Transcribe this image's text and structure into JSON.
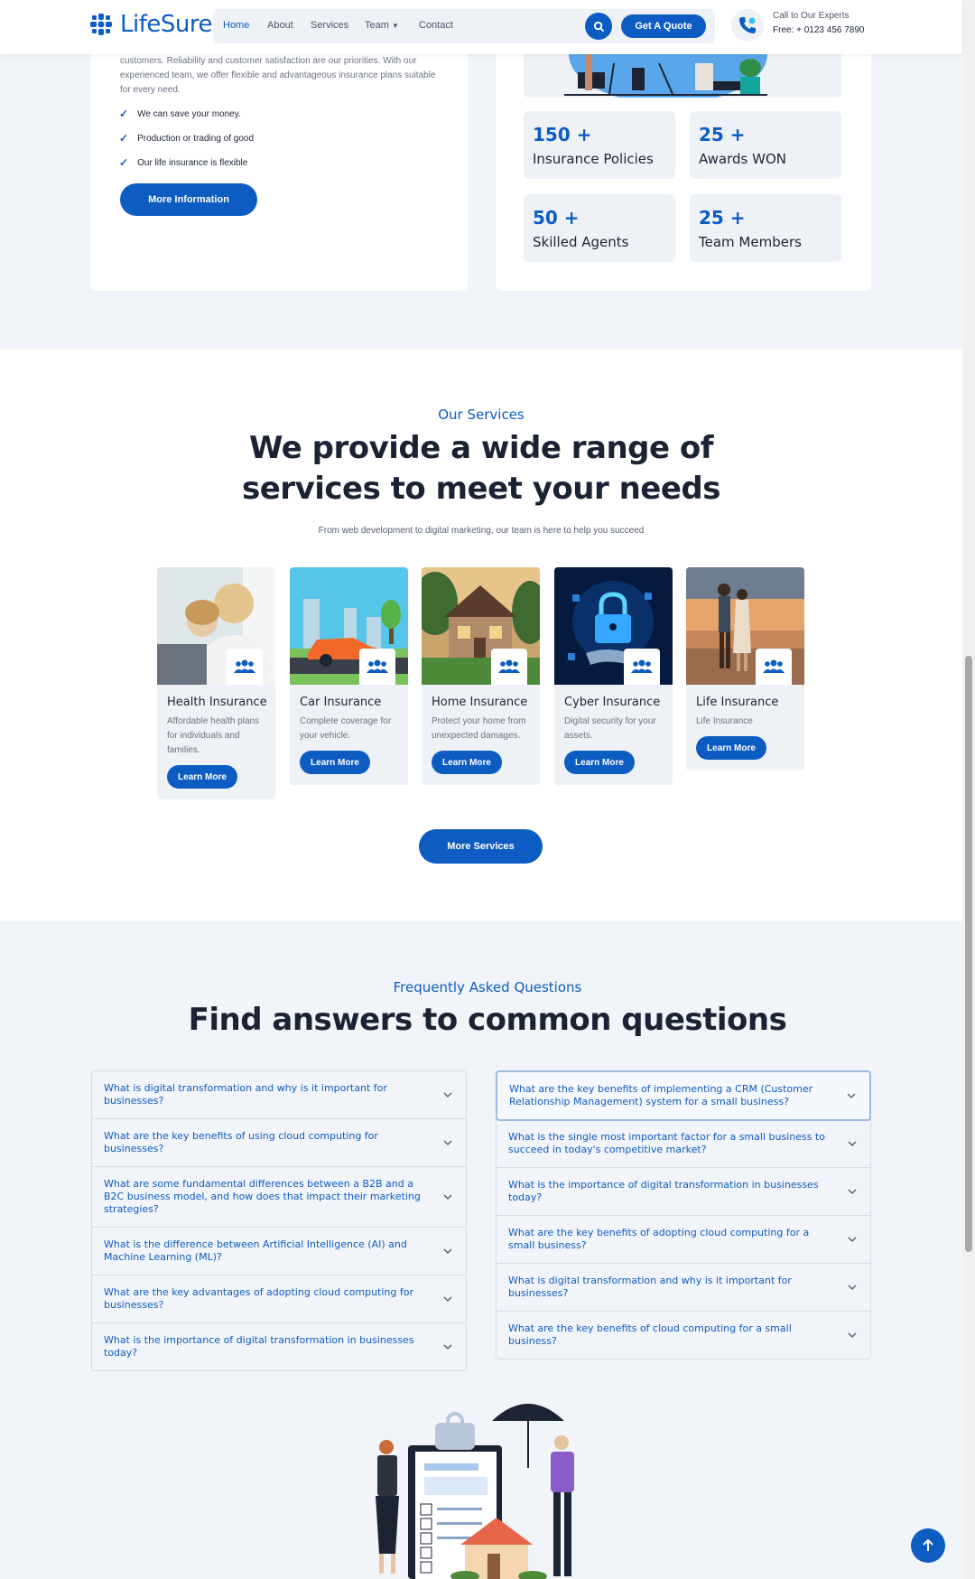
{
  "header": {
    "brand": "LifeSure",
    "nav": [
      {
        "label": "Home"
      },
      {
        "label": "About"
      },
      {
        "label": "Services"
      },
      {
        "label": "Team"
      },
      {
        "label": "Contact"
      }
    ],
    "quote_label": "Get A Quote",
    "call_label": "Call to Our Experts",
    "call_number": "Free: + 0123 456 7890"
  },
  "about": {
    "text": "customers. Reliability and customer satisfaction are our priorities. With our experienced team, we offer flexible and advantageous insurance plans suitable for every need.",
    "checks": [
      "We can save your money.",
      "Production or trading of good",
      "Our life insurance is flexible"
    ],
    "button": "More Information"
  },
  "stats": [
    {
      "num": "150 +",
      "label": "Insurance Policies"
    },
    {
      "num": "25 +",
      "label": "Awards WON"
    },
    {
      "num": "50 +",
      "label": "Skilled Agents"
    },
    {
      "num": "25 +",
      "label": "Team Members"
    }
  ],
  "services": {
    "eyebrow": "Our Services",
    "headline_1": "We provide a wide range of",
    "headline_2": "services to meet your needs",
    "subline": "From web development to digital marketing, our team is here to help you succeed",
    "items": [
      {
        "title": "Health Insurance",
        "desc": "Affordable health plans for individuals and families.",
        "btn": "Learn More"
      },
      {
        "title": "Car Insurance",
        "desc": "Complete coverage for your vehicle.",
        "btn": "Learn More"
      },
      {
        "title": "Home Insurance",
        "desc": "Protect your home from unexpected damages.",
        "btn": "Learn More"
      },
      {
        "title": "Cyber Insurance",
        "desc": "Digital security for your assets.",
        "btn": "Learn More"
      },
      {
        "title": "Life Insurance",
        "desc": "Life Insurance",
        "btn": "Learn More"
      }
    ],
    "more_button": "More Services"
  },
  "faq": {
    "eyebrow": "Frequently Asked Questions",
    "headline": "Find answers to common questions",
    "left": [
      "What is digital transformation and why is it important for businesses?",
      "What are the key benefits of using cloud computing for businesses?",
      "What are some fundamental differences between a B2B and a B2C business model, and how does that impact their marketing strategies?",
      "What is the difference between Artificial Intelligence (AI) and Machine Learning (ML)?",
      "What are the key advantages of adopting cloud computing for businesses?",
      "What is the importance of digital transformation in businesses today?"
    ],
    "right": [
      "What are the key benefits of implementing a CRM (Customer Relationship Management) system for a small business?",
      "What is the single most important factor for a small business to succeed in today's competitive market?",
      "What is the importance of digital transformation in businesses today?",
      "What are the key benefits of adopting cloud computing for a small business?",
      "What is digital transformation and why is it important for businesses?",
      "What are the key benefits of cloud computing for a small business?"
    ]
  },
  "colors": {
    "accent": "#0d5cc2",
    "heading": "#1a2233",
    "bg": "#f1f4f9"
  }
}
